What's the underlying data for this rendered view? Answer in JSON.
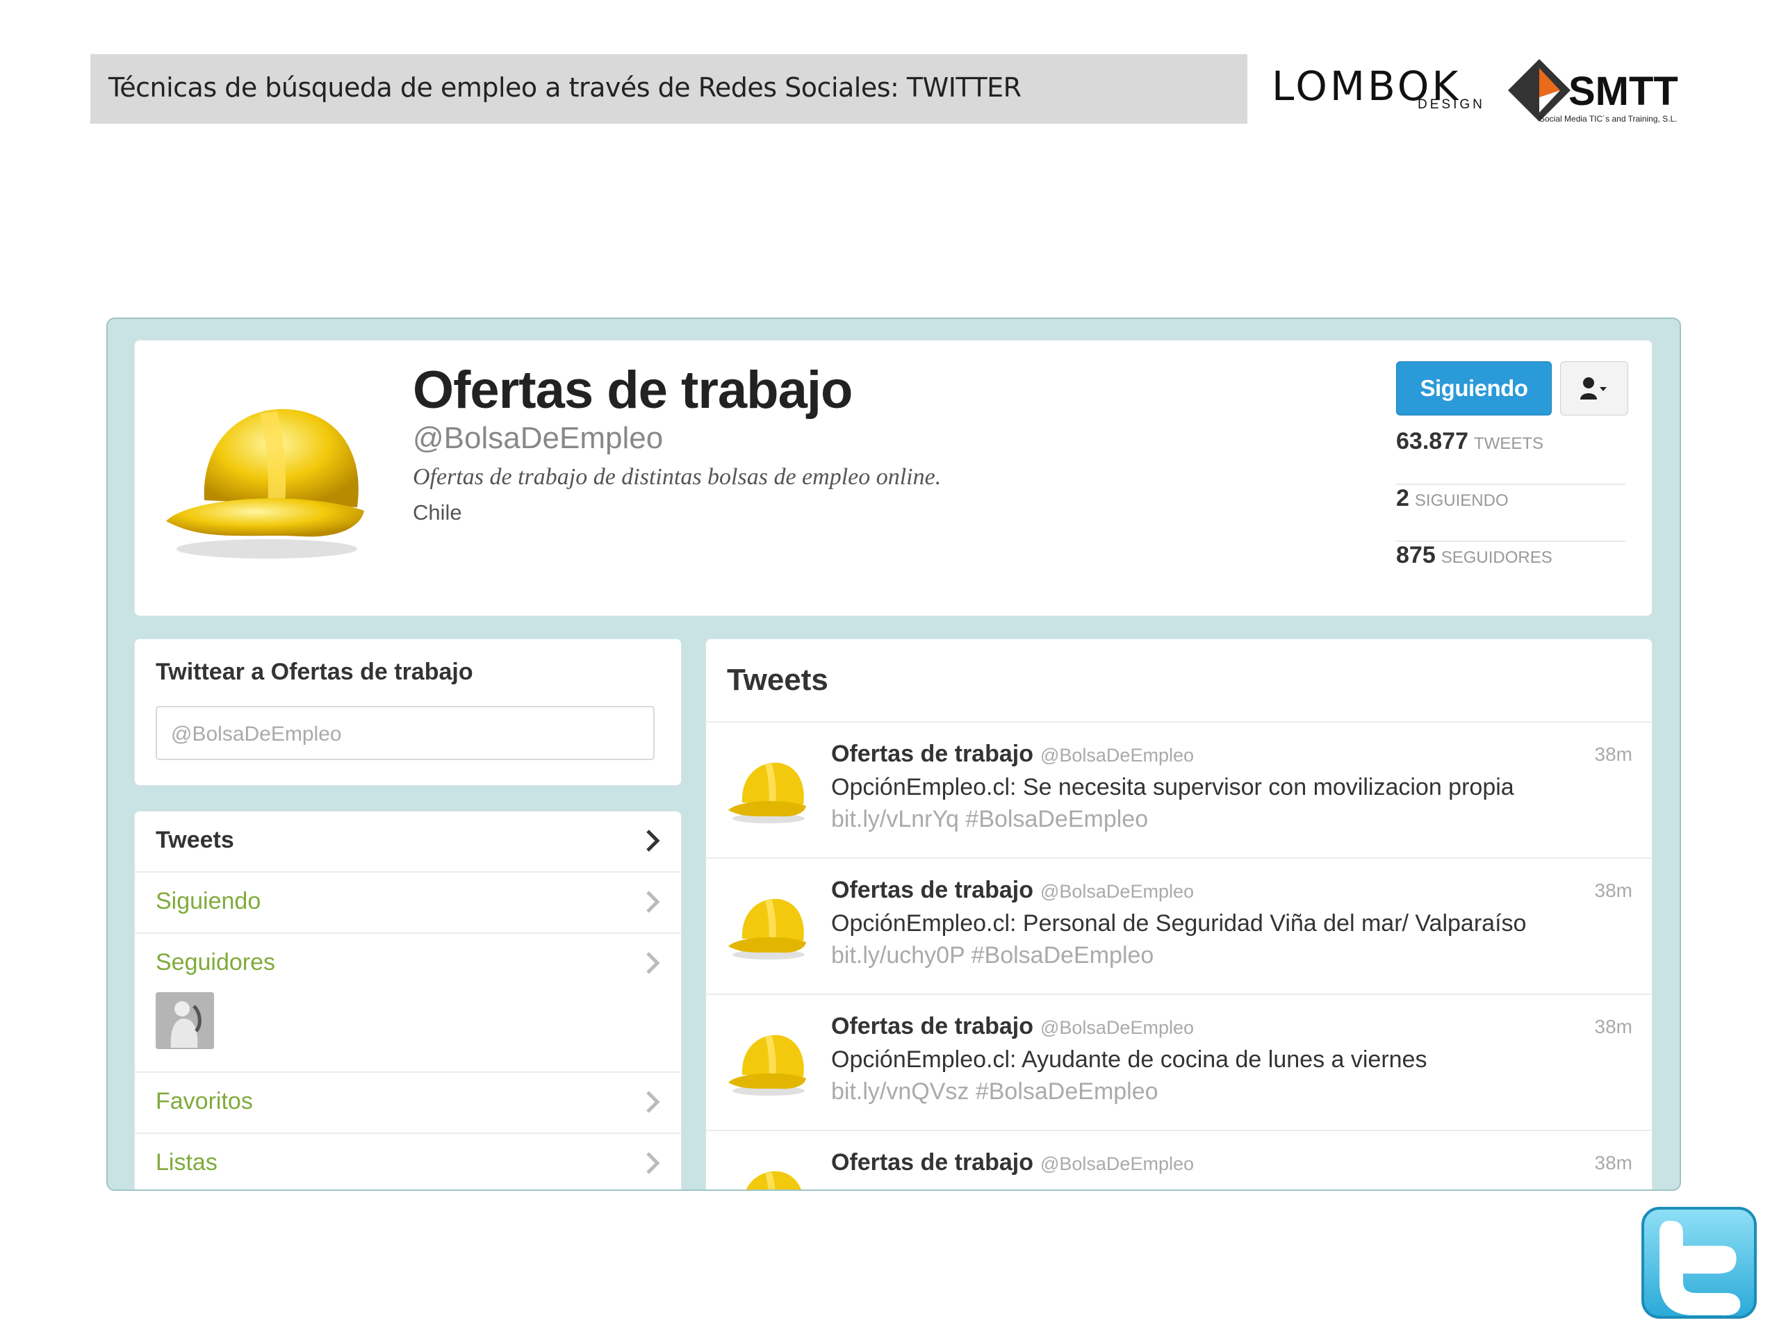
{
  "slide": {
    "title": "Técnicas de búsqueda de empleo a través de Redes Sociales: TWITTER",
    "logo_lombok": "LOMBOK",
    "logo_lombok_sub": "DESIGN",
    "logo_smtt": "SMTT",
    "logo_smtt_sub": "Social Media TIC´s and Training, S.L."
  },
  "profile": {
    "name": "Ofertas de trabajo",
    "handle": "@BolsaDeEmpleo",
    "bio": "Ofertas de trabajo de distintas bolsas de empleo online.",
    "location": "Chile",
    "follow_button": "Siguiendo",
    "stats": [
      {
        "num": "63.877",
        "label": "TWEETS"
      },
      {
        "num": "2",
        "label": "SIGUIENDO"
      },
      {
        "num": "875",
        "label": "SEGUIDORES"
      }
    ]
  },
  "compose": {
    "title": "Twittear a Ofertas de trabajo",
    "placeholder": "@BolsaDeEmpleo"
  },
  "nav": {
    "items": [
      {
        "label": "Tweets"
      },
      {
        "label": "Siguiendo"
      },
      {
        "label": "Seguidores"
      },
      {
        "label": "Favoritos"
      },
      {
        "label": "Listas"
      }
    ]
  },
  "timeline": {
    "title": "Tweets",
    "tweets": [
      {
        "author": "Ofertas de trabajo",
        "handle": "@BolsaDeEmpleo",
        "time": "38m",
        "text": "OpciónEmpleo.cl: Se necesita supervisor con movilizacion propia",
        "link": "bit.ly/vLnrYq",
        "hashtag": "#BolsaDeEmpleo"
      },
      {
        "author": "Ofertas de trabajo",
        "handle": "@BolsaDeEmpleo",
        "time": "38m",
        "text": "OpciónEmpleo.cl: Personal de Seguridad Viña del mar/ Valparaíso",
        "link": "bit.ly/uchy0P",
        "hashtag": "#BolsaDeEmpleo"
      },
      {
        "author": "Ofertas de trabajo",
        "handle": "@BolsaDeEmpleo",
        "time": "38m",
        "text": "OpciónEmpleo.cl: Ayudante de cocina de lunes a viernes",
        "link": "bit.ly/vnQVsz",
        "hashtag": "#BolsaDeEmpleo"
      },
      {
        "author": "Ofertas de trabajo",
        "handle": "@BolsaDeEmpleo",
        "time": "38m",
        "text": "",
        "link": "",
        "hashtag": ""
      }
    ]
  },
  "colors": {
    "accent_blue": "#2a9ad9",
    "link_green": "#7fab3b",
    "frame_teal": "#c9e3e4"
  },
  "icons": [
    "helmet-icon",
    "user-icon",
    "chevron-right-icon",
    "twitter-bird-icon"
  ]
}
